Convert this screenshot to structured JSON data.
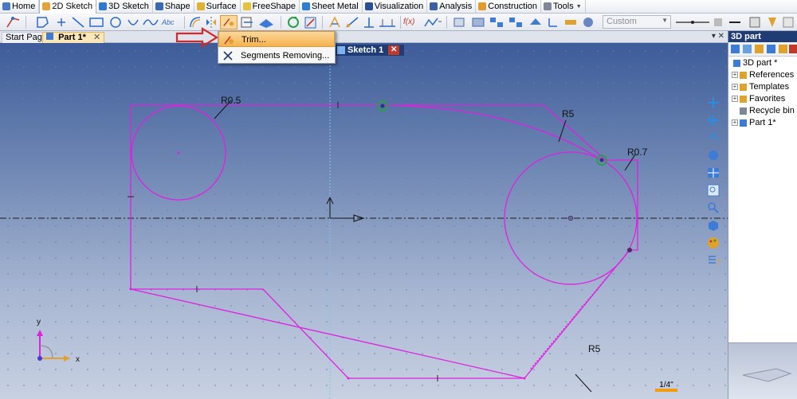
{
  "menu": {
    "tabs": [
      {
        "label": "Home",
        "icon": "home-icon",
        "active": false
      },
      {
        "label": "2D Sketch",
        "icon": "sketch2d-icon",
        "active": true
      },
      {
        "label": "3D Sketch",
        "icon": "sketch3d-icon",
        "active": false
      },
      {
        "label": "Shape",
        "icon": "shape-icon",
        "active": false
      },
      {
        "label": "Surface",
        "icon": "surface-icon",
        "active": false
      },
      {
        "label": "FreeShape",
        "icon": "freeshape-icon",
        "active": false
      },
      {
        "label": "Sheet Metal",
        "icon": "sheet-metal-icon",
        "active": false
      },
      {
        "label": "Visualization",
        "icon": "visualization-icon",
        "active": false
      },
      {
        "label": "Analysis",
        "icon": "analysis-icon",
        "active": false
      },
      {
        "label": "Construction",
        "icon": "construction-icon",
        "active": false
      },
      {
        "label": "Tools",
        "icon": "tools-icon",
        "active": false
      }
    ]
  },
  "toolbar": {
    "text_tool_label": "Abc",
    "formula_label": "f(x)",
    "style_dropdown": "Custom"
  },
  "doc_tabs": {
    "start": "Start Page",
    "part": "Part 1*"
  },
  "sketch": {
    "label": "Sketch 1",
    "close": "✕",
    "dimensions": [
      "R0.5",
      "R5",
      "R0.7",
      "R5"
    ],
    "axis_x": "x",
    "axis_y": "y",
    "scale": "1/4\""
  },
  "context_menu": {
    "items": [
      {
        "label": "Trim...",
        "icon": "trim-icon",
        "highlighted": true
      },
      {
        "label": "Segments Removing...",
        "icon": "segments-removing-icon",
        "highlighted": false
      }
    ]
  },
  "panel": {
    "title": "3D part",
    "tree": [
      {
        "label": "3D part *",
        "icon": "part-icon",
        "expandable": false,
        "level": 0
      },
      {
        "label": "References",
        "icon": "references-icon",
        "expandable": true,
        "level": 1
      },
      {
        "label": "Templates",
        "icon": "templates-icon",
        "expandable": true,
        "level": 1
      },
      {
        "label": "Favorites",
        "icon": "favorites-icon",
        "expandable": true,
        "level": 1
      },
      {
        "label": "Recycle bin",
        "icon": "recycle-bin-icon",
        "expandable": false,
        "level": 1
      },
      {
        "label": "Part 1*",
        "icon": "part1-icon",
        "expandable": true,
        "level": 1
      }
    ]
  },
  "colors": {
    "sketch_line": "#e020e0",
    "axis": "#1a1a1a",
    "accent_orange": "#f39c12",
    "arrow_red": "#d62828",
    "panel_title": "#1f3d74"
  }
}
